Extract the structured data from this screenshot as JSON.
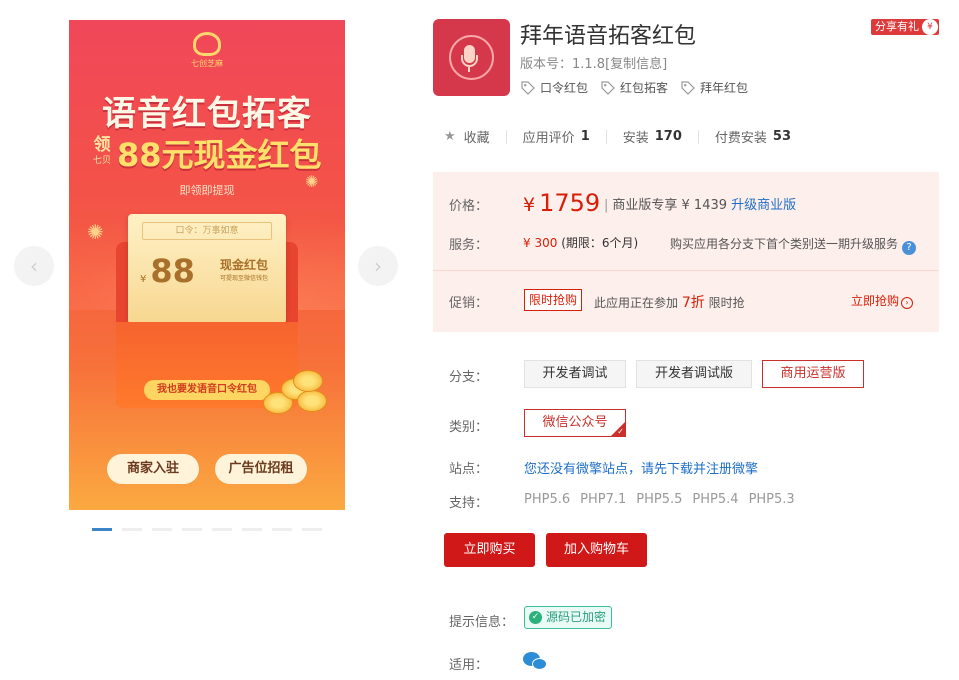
{
  "gallery": {
    "prev_icon": "chevron-left-icon",
    "next_icon": "chevron-right-icon",
    "prev_glyph": "‹",
    "next_glyph": "›",
    "poster": {
      "logo_text": "七创芝麻",
      "title": "语音红包拓客",
      "ling": "领",
      "ling_small": "七贝",
      "headline": "88元现金红包",
      "tagline": "即领即提现",
      "card_code": "口令：万事如意",
      "card_yen": "¥",
      "card_amount": "88",
      "card_desc": "现金红包",
      "card_desc_small": "可提现至微信钱包",
      "envelope_button": "我也要发语音口令红包",
      "button_merchant": "商家入驻",
      "button_ads": "广告位招租"
    },
    "dots_count": 8,
    "active_dot": 0
  },
  "app": {
    "title": "拜年语音拓客红包",
    "icon": "microphone-icon",
    "share_label": "分享有礼",
    "share_gift_glyph": "¥",
    "version_label": "版本号：1.1.8",
    "copy_info": "[复制信息]",
    "tags": [
      "口令红包",
      "红包拓客",
      "拜年红包"
    ]
  },
  "stats": {
    "favorite": "收藏",
    "rating_label": "应用评价",
    "rating_value": "1",
    "install_label": "安装",
    "install_value": "170",
    "paid_label": "付费安装",
    "paid_value": "53"
  },
  "pricing": {
    "price_label": "价格：",
    "yen": "¥",
    "price": "1759",
    "biz_text": "商业版专享 ¥ 1439",
    "upgrade_link": "升级商业版",
    "service_label": "服务：",
    "service_price": "¥ 300",
    "service_period": "(期限：6个月)",
    "service_note": "购买应用各分支下首个类别送一期升级服务",
    "promo_label": "促销：",
    "promo_badge": "限时抢购",
    "promo_text_before": "此应用正在参加",
    "promo_discount": "7折",
    "promo_text_after": "限时抢",
    "promo_buy": "立即抢购"
  },
  "options": {
    "branch_label": "分支：",
    "branches": [
      "开发者调试",
      "开发者调试版",
      "商用运营版"
    ],
    "selected_branch": 2,
    "category_label": "类别：",
    "category": "微信公众号",
    "site_label": "站点：",
    "site_link": "您还没有微擎站点，请先下载并注册微擎",
    "support_label": "支持：",
    "php_versions": [
      "PHP5.6",
      "PHP7.1",
      "PHP5.5",
      "PHP5.4",
      "PHP5.3"
    ]
  },
  "actions": {
    "buy": "立即购买",
    "cart": "加入购物车"
  },
  "footer": {
    "hint_label": "提示信息：",
    "encrypted": "源码已加密",
    "apply_label": "适用：",
    "apply_icon": "wechat-icon"
  },
  "colors": {
    "accent_red": "#d01818",
    "link_blue": "#1f6fc7",
    "price_bg": "#fdefec",
    "active_dot": "#3d85c6"
  }
}
